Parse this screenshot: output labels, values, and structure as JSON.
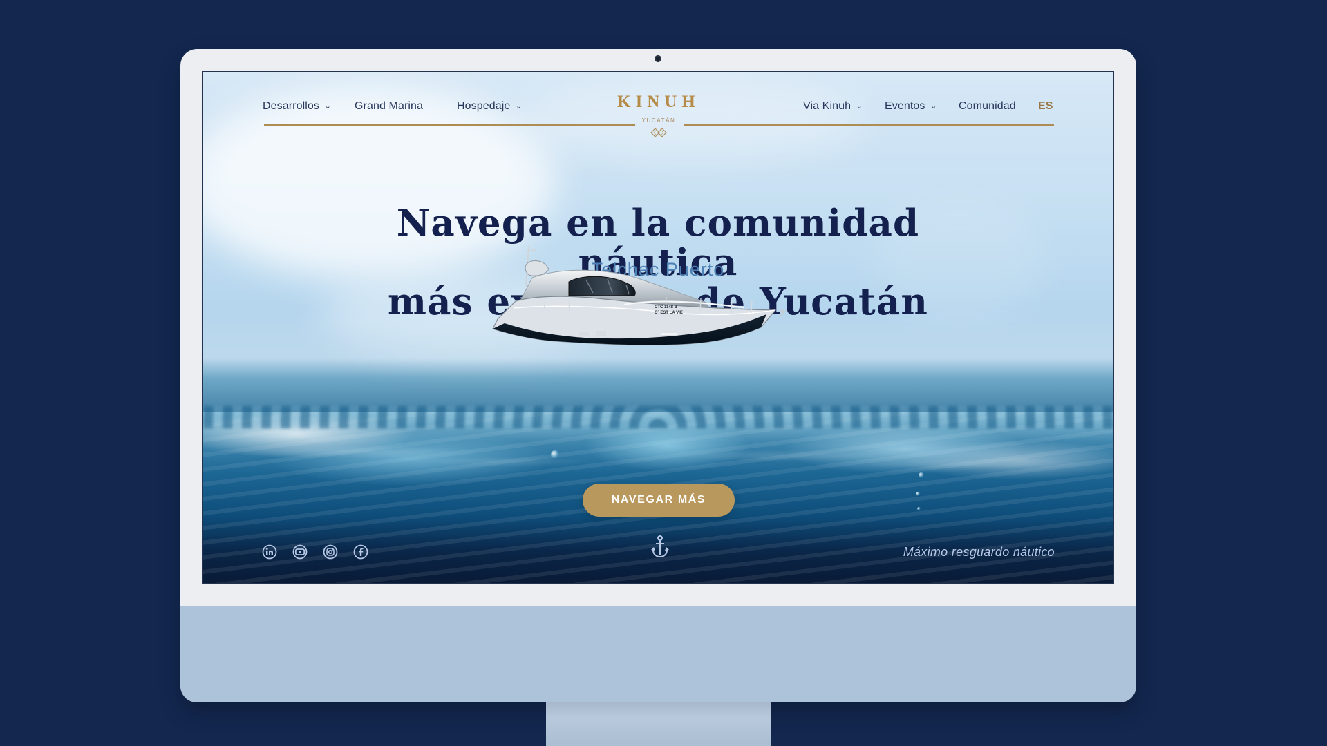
{
  "navigation": {
    "left": [
      {
        "label": "Desarrollos",
        "chevron": "⌄"
      },
      {
        "label": "Grand Marina",
        "chevron": ""
      },
      {
        "label": "Hospedaje",
        "chevron": "⌄"
      }
    ],
    "right": [
      {
        "label": "Via Kinuh",
        "chevron": "⌄"
      },
      {
        "label": "Eventos",
        "chevron": "⌄"
      },
      {
        "label": "Comunidad",
        "chevron": ""
      },
      {
        "label": "ES",
        "chevron": ""
      }
    ]
  },
  "brand": {
    "name": "KINUH",
    "region": "YUCATÁN"
  },
  "hero": {
    "title": "Navega en la comunidad náutica\nmás exclusiva de Yucatán",
    "subtitle": "Telchac Puerto",
    "cta": "NAVEGAR MÁS",
    "yacht_registration": "CTC 1148 B",
    "yacht_name": "C° EST LA VIE"
  },
  "footer": {
    "tagline": "Máximo resguardo náutico",
    "social_icons": [
      "linkedin-icon",
      "youtube-icon",
      "instagram-icon",
      "facebook-icon"
    ]
  },
  "colors": {
    "page_background": "#13274f",
    "brand_gold": "#b68b48",
    "title_navy": "#14204d",
    "subtitle_blue": "#4d81b5",
    "social_icon_blue": "#b8c9e6"
  }
}
